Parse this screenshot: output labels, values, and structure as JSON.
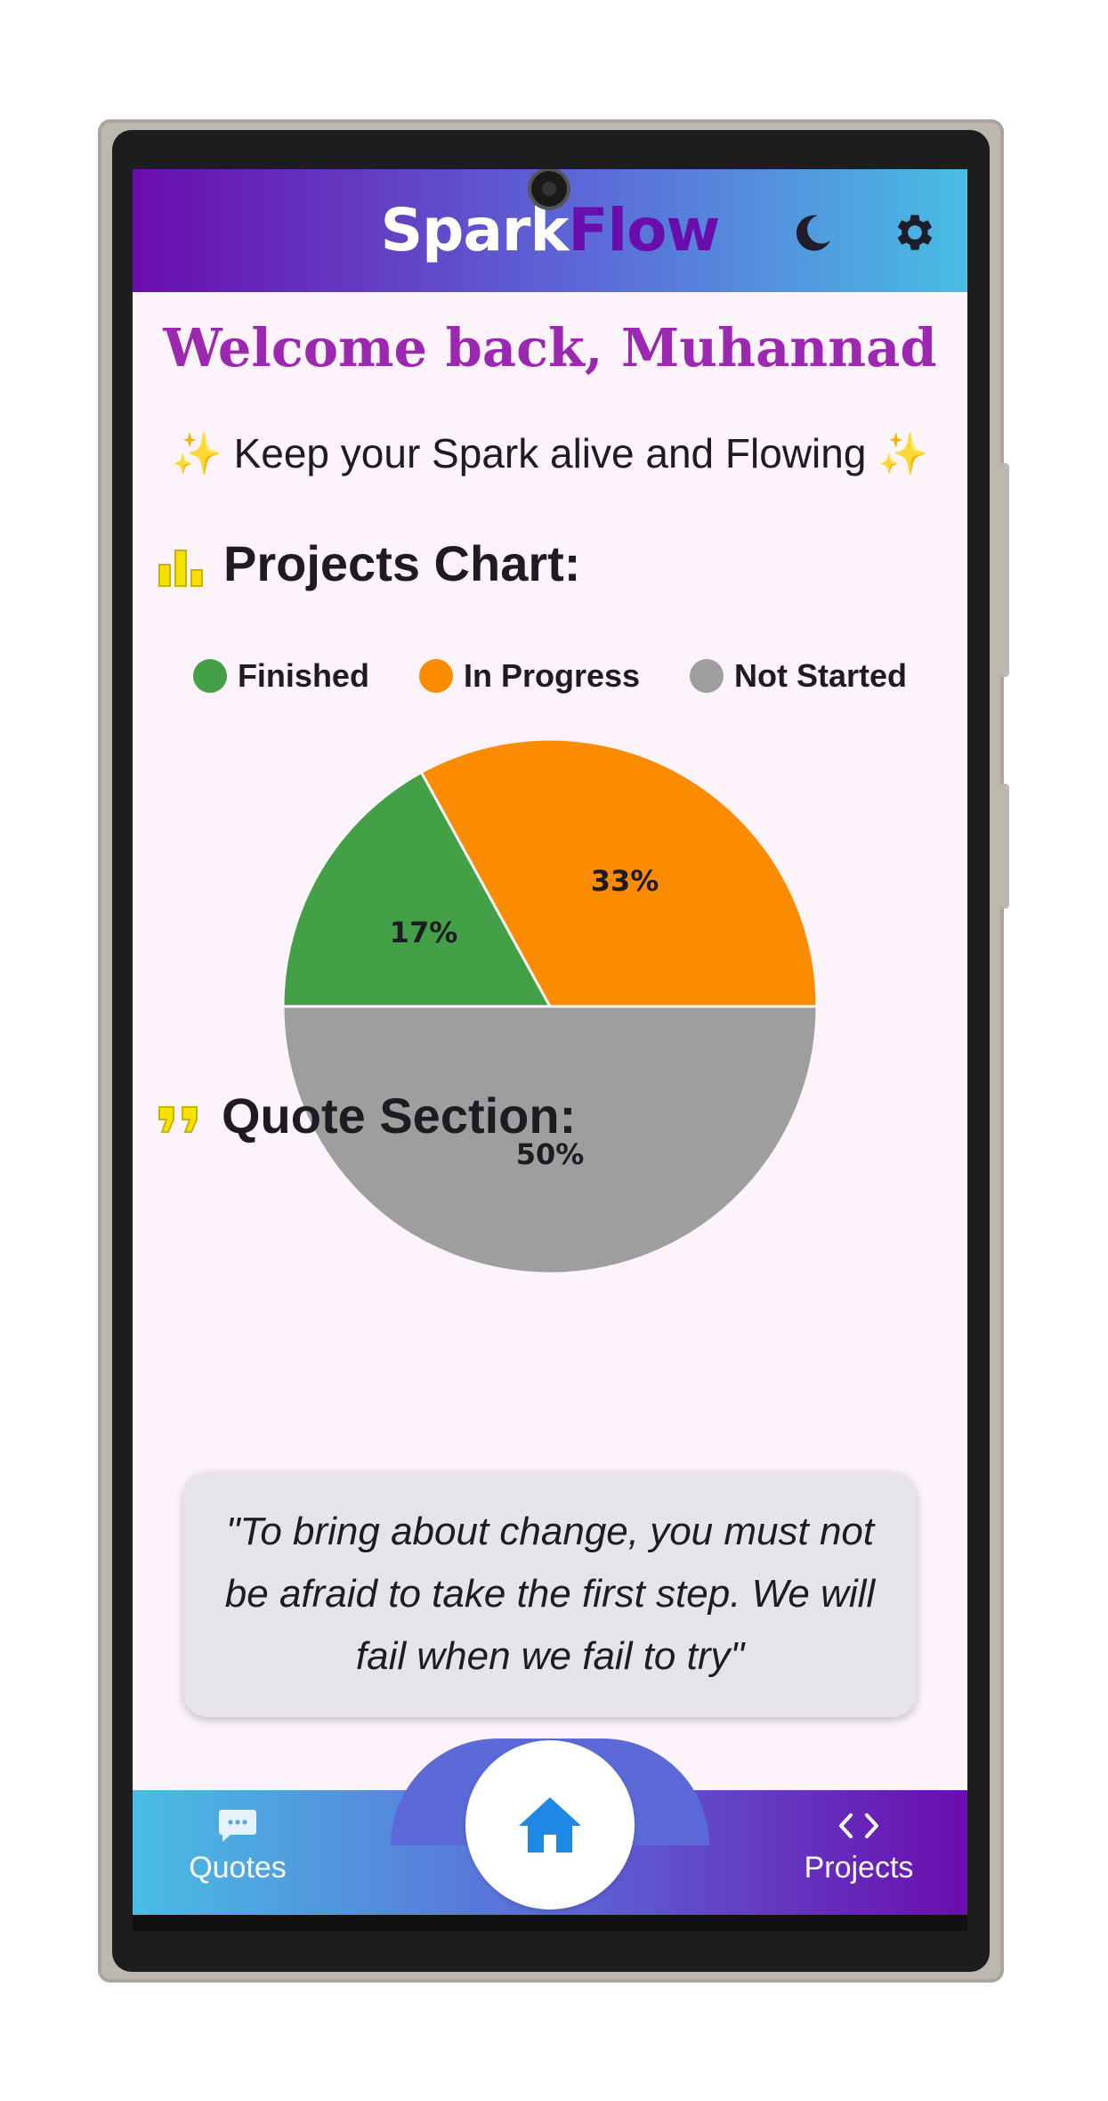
{
  "app": {
    "brand_part1": "Spark",
    "brand_part2": "Flow",
    "icons": [
      "moon-icon",
      "gear-icon"
    ]
  },
  "home": {
    "welcome": "Welcome back, Muhannad",
    "tagline": "Keep your Spark alive and Flowing",
    "tagline_icon": "sparkles-emoji",
    "chart_section_title": "Projects Chart:",
    "quote_section_title": "Quote Section:",
    "quote": "\"To bring about change, you must not be afraid to take the first step. We will fail when we fail to try\""
  },
  "chart_data": {
    "type": "pie",
    "legend_position": "top",
    "slices": [
      {
        "label": "Finished",
        "value": 17,
        "display": "17%",
        "color": "#43a047"
      },
      {
        "label": "In Progress",
        "value": 33,
        "display": "33%",
        "color": "#fb8c00"
      },
      {
        "label": "Not Started",
        "value": 50,
        "display": "50%",
        "color": "#9e9e9e"
      }
    ]
  },
  "nav": {
    "quotes_label": "Quotes",
    "projects_label": "Projects",
    "home_icon": "home-icon"
  },
  "colors": {
    "accent_purple": "#6a0dad",
    "welcome_purple": "#9c27b0",
    "gradient_end": "#49bde3"
  }
}
